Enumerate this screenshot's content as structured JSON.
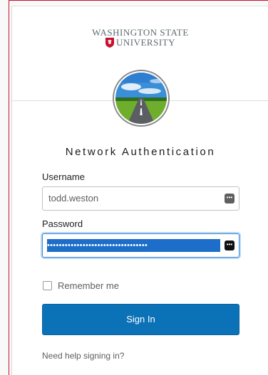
{
  "branding": {
    "line1": "WASHINGTON STATE",
    "line2": "UNIVERSITY",
    "accent_color": "#c8102e"
  },
  "avatar": {
    "icon": "road-landscape-image"
  },
  "form": {
    "title": "Network Authentication",
    "username_label": "Username",
    "username_value": "todd.weston",
    "password_label": "Password",
    "password_value": "••••••••••••••••••••••••••••••••••",
    "password_manager_icon": "key-dots-icon",
    "remember_label": "Remember me",
    "remember_checked": false,
    "signin_label": "Sign In",
    "help_link": "Need help signing in?",
    "button_color": "#0b72b7"
  }
}
